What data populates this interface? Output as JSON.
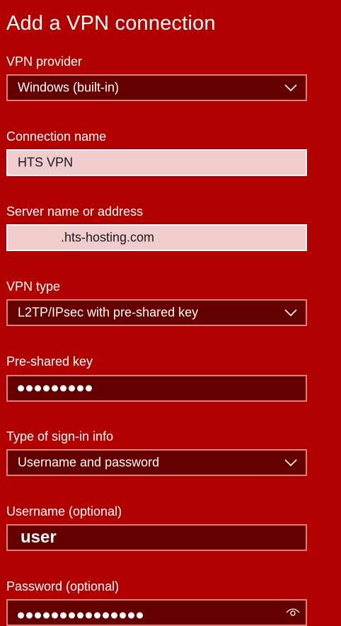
{
  "title": "Add a VPN connection",
  "vpn_provider": {
    "label": "VPN provider",
    "value": "Windows (built-in)"
  },
  "connection_name": {
    "label": "Connection name",
    "value": "HTS VPN"
  },
  "server": {
    "label": "Server name or address",
    "value": ".hts-hosting.com"
  },
  "vpn_type": {
    "label": "VPN type",
    "value": "L2TP/IPsec with pre-shared key"
  },
  "pre_shared_key": {
    "label": "Pre-shared key",
    "masked_length": 9
  },
  "sign_in_type": {
    "label": "Type of sign-in info",
    "value": "Username and password"
  },
  "username": {
    "label": "Username (optional)",
    "value": "user"
  },
  "password": {
    "label": "Password (optional)",
    "masked_length": 15
  },
  "colors": {
    "background": "#b00000",
    "field_dark": "#640000",
    "field_light": "#f0cccc",
    "field_border": "#e27d7d"
  },
  "icons": {
    "dropdown": "chevron-down-icon",
    "reveal": "eye-icon"
  }
}
